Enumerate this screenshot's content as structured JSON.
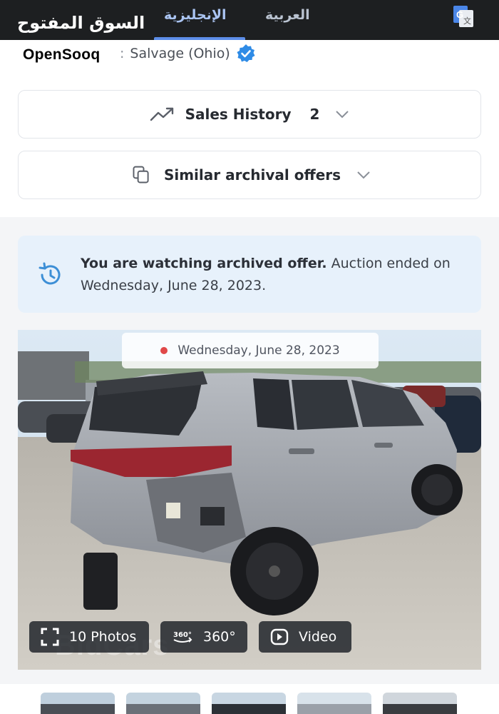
{
  "translate_bar": {
    "tab_arabic": "العربية",
    "tab_english": "الإنجليزية",
    "active_tab": "الإنجليزية",
    "accent_color": "#5c8de8"
  },
  "logo": {
    "arabic": "السوق المفتوح",
    "english": "OpenSooq"
  },
  "seller": {
    "label_suffix": ":",
    "name": "Salvage (Ohio)",
    "verified_icon": "verified-badge-icon"
  },
  "accordions": {
    "sales_history": {
      "label": "Sales History",
      "count": "2",
      "icon": "trend-line-icon"
    },
    "similar": {
      "label": "Similar archival offers",
      "icon": "copy-icon"
    }
  },
  "notice": {
    "bold": "You are watching archived offer.",
    "rest": " Auction ended on Wednesday, June 28, 2023.",
    "icon": "history-icon",
    "background": "#e7f1fb"
  },
  "photo": {
    "date_label": "Wednesday, June 28, 2023",
    "watermark": "BidCars",
    "buttons": {
      "photos": "10 Photos",
      "p360_badge": "360°",
      "p360": "360°",
      "video": "Video"
    }
  }
}
